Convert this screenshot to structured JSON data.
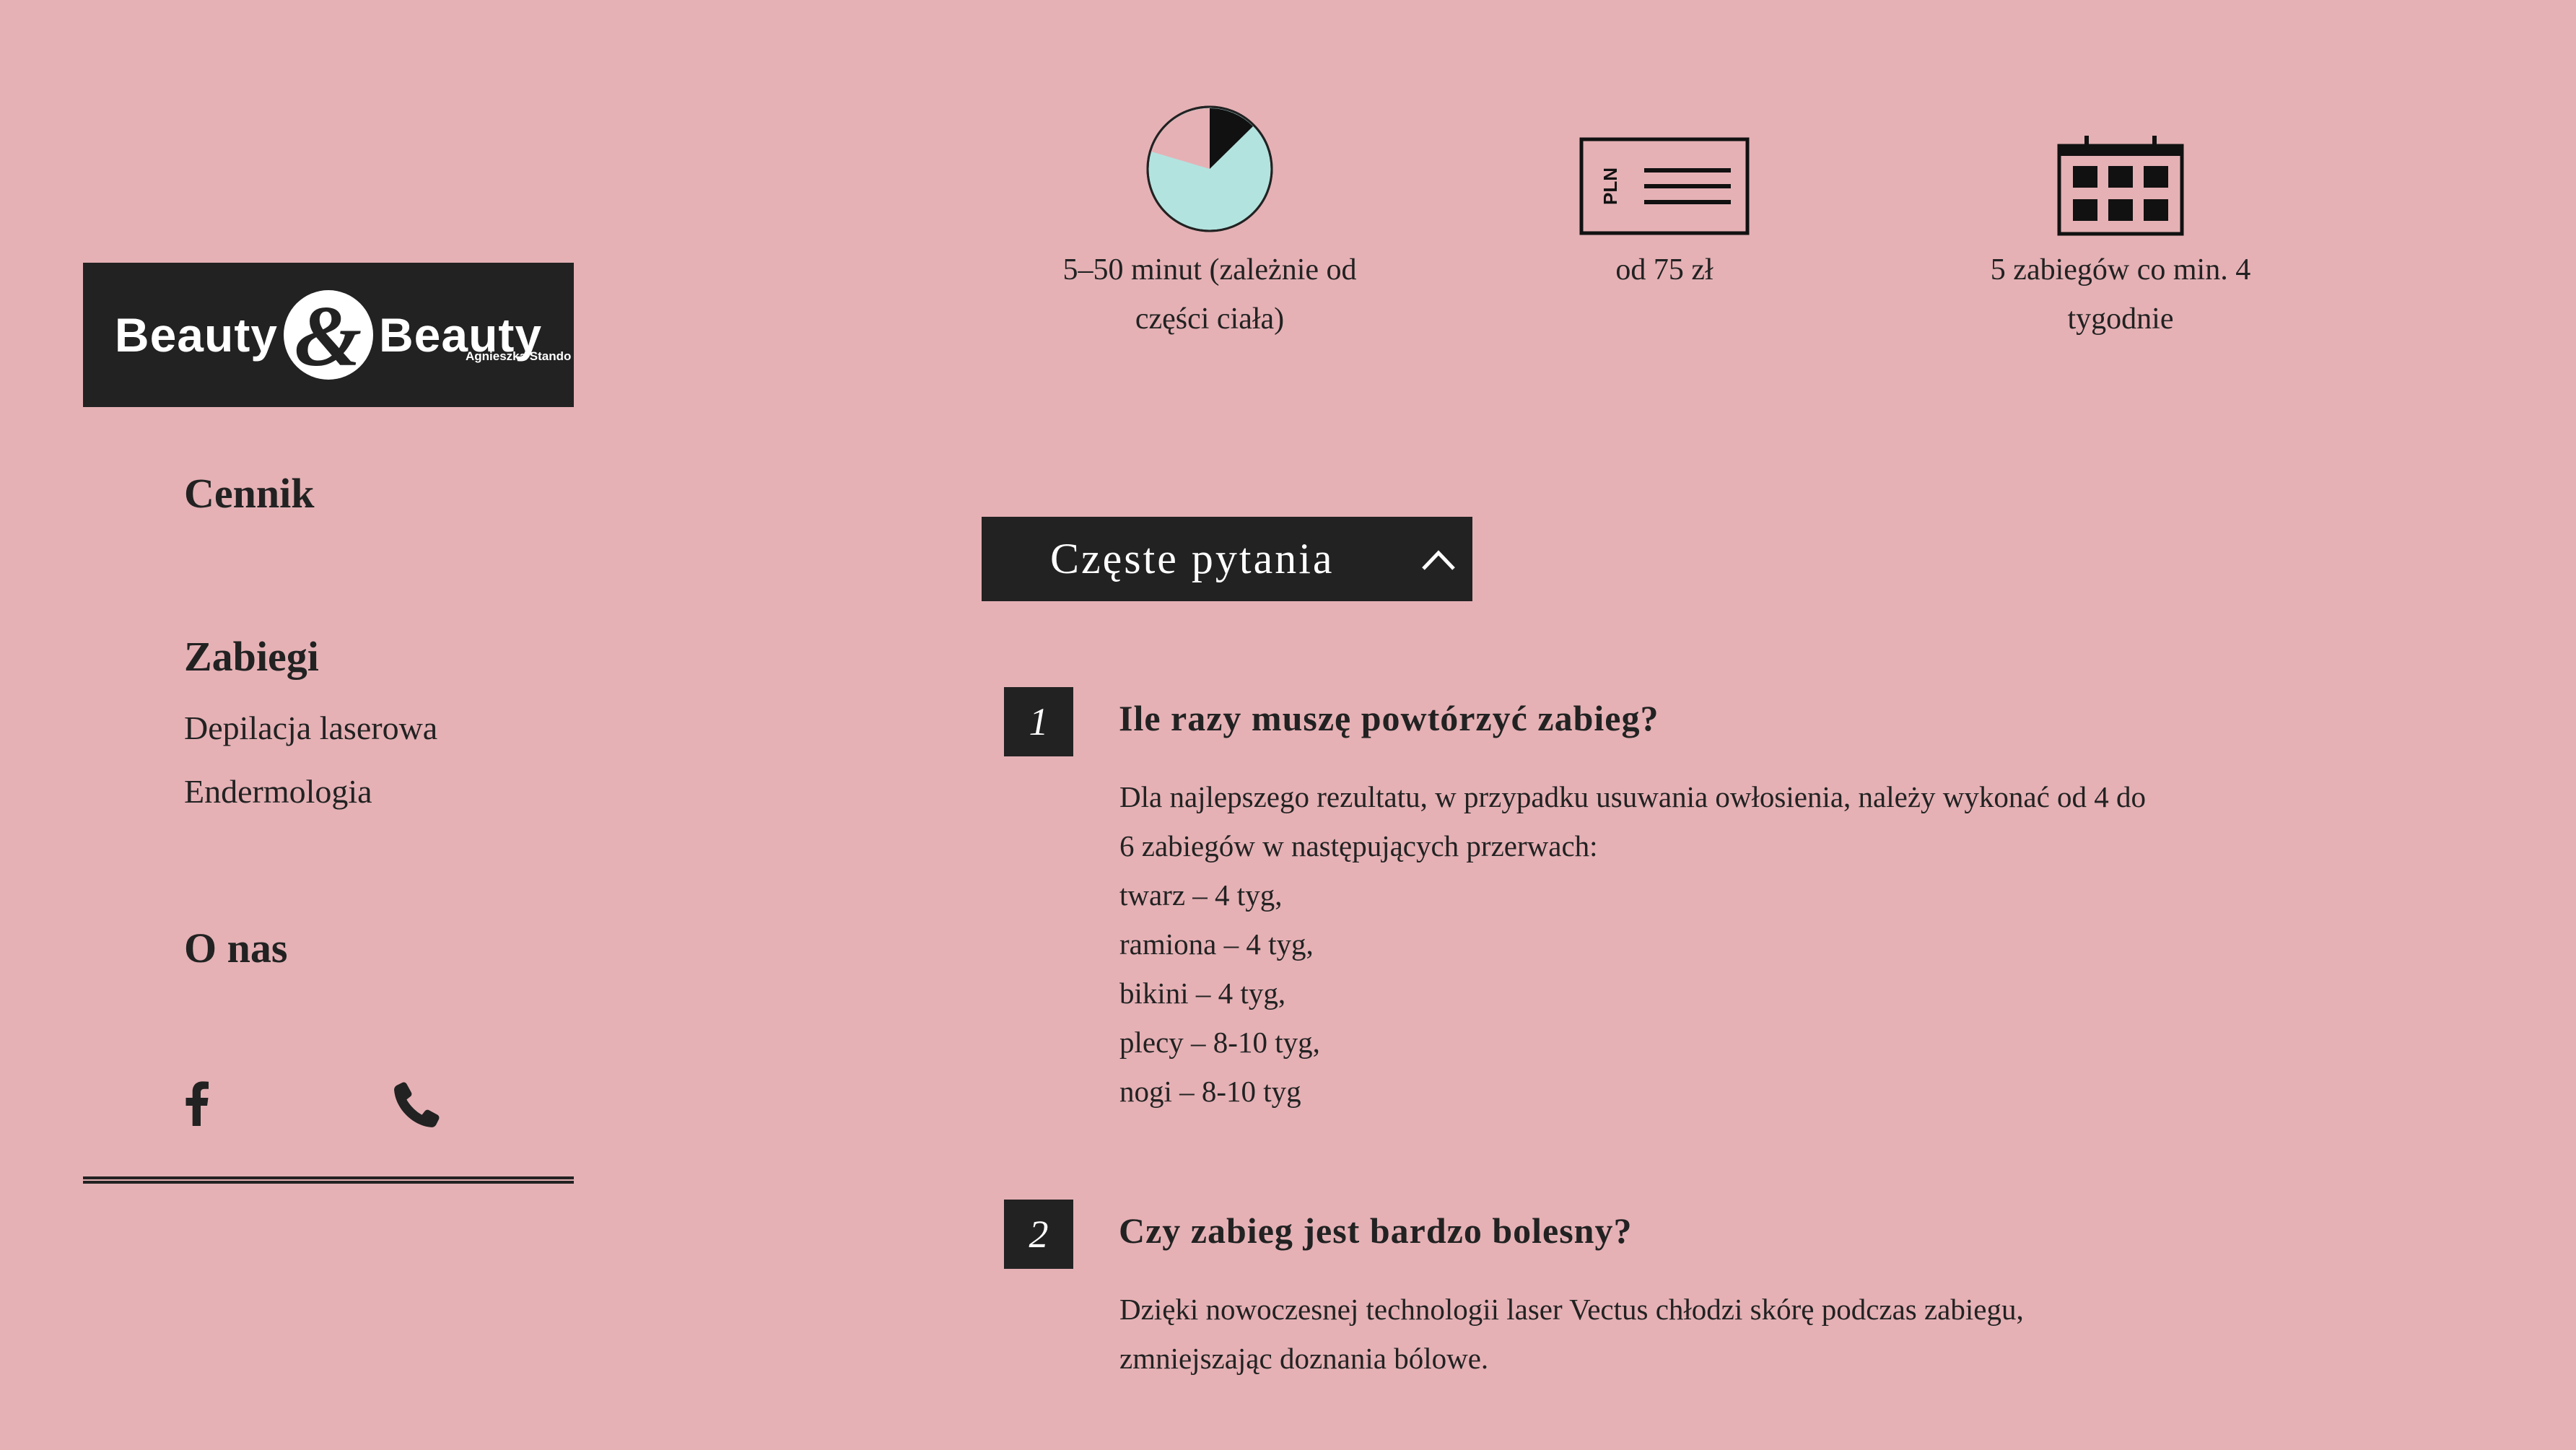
{
  "logo": {
    "left_word": "Beauty",
    "ampersand": "&",
    "right_word": "Beauty",
    "subtitle": "Agnieszka Stando"
  },
  "nav": {
    "cennik": "Cennik",
    "zabiegi": "Zabiegi",
    "zabiegi_items": [
      "Depilacja laserowa",
      "Endermologia"
    ],
    "o_nas": "O nas"
  },
  "social": {
    "facebook_icon": "facebook-icon",
    "phone_icon": "phone-icon"
  },
  "stats": [
    {
      "icon": "clock-pie-icon",
      "line1": "5–50 minut (zależnie od",
      "line2": "części ciała)"
    },
    {
      "icon": "pln-banknote-icon",
      "icon_text": "PLN",
      "line1": "od 75 zł",
      "line2": ""
    },
    {
      "icon": "calendar-icon",
      "line1": "5 zabiegów co min. 4",
      "line2": "tygodnie"
    }
  ],
  "colors": {
    "background": "#e5b1b5",
    "dark": "#222222",
    "pie_fill": "#b3e3df"
  },
  "faq": {
    "header": "Częste pytania",
    "questions": [
      {
        "number": "1",
        "title": "Ile razy muszę powtórzyć zabieg?",
        "answer_lines": [
          "Dla najlepszego rezultatu, w przypadku usuwania owłosienia, należy wykonać od 4 do",
          "6 zabiegów w następujących przerwach:",
          "twarz – 4 tyg,",
          "ramiona – 4 tyg,",
          "bikini – 4 tyg,",
          "plecy – 8-10 tyg,",
          "nogi – 8-10 tyg"
        ]
      },
      {
        "number": "2",
        "title": "Czy zabieg jest bardzo bolesny?",
        "answer_lines": [
          "Dzięki nowoczesnej technologii laser Vectus chłodzi skórę podczas zabiegu,",
          "zmniejszając doznania bólowe."
        ]
      }
    ]
  }
}
